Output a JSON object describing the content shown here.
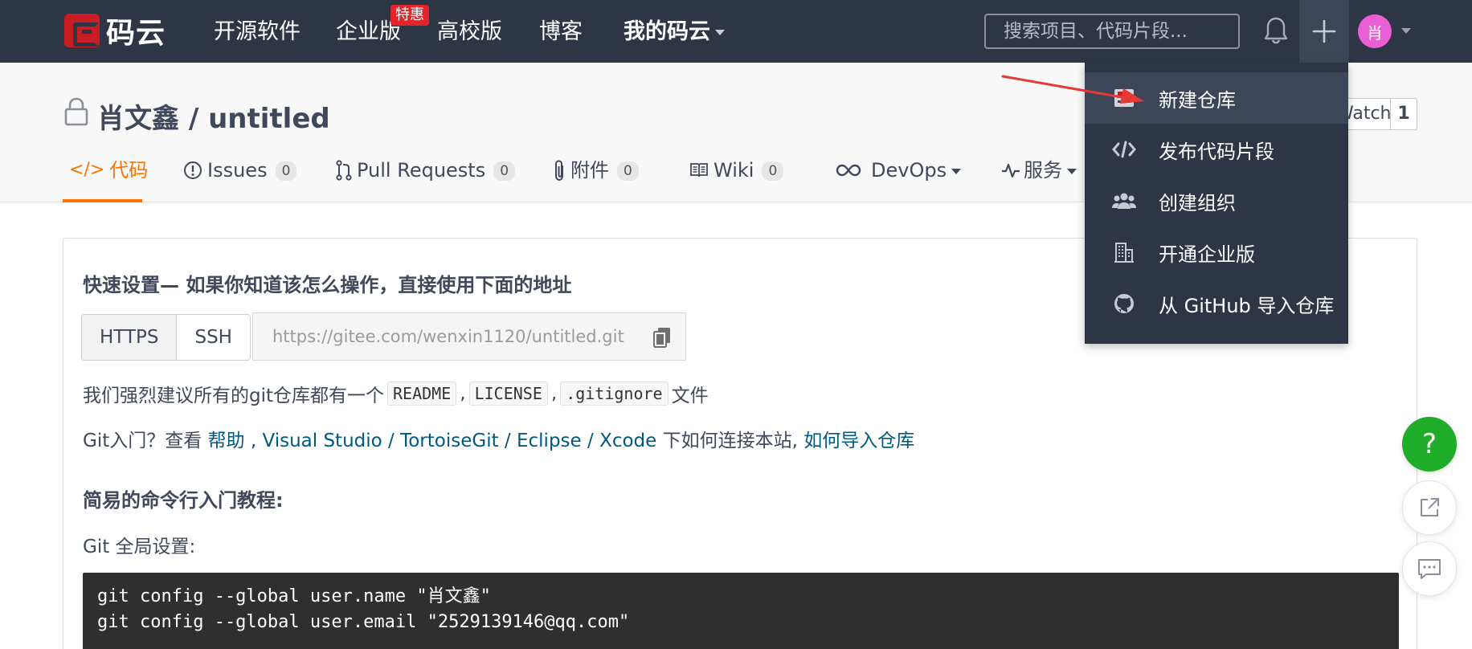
{
  "navbar": {
    "brand": "码云",
    "links": [
      {
        "label": "开源软件"
      },
      {
        "label": "企业版",
        "badge": "特惠"
      },
      {
        "label": "高校版"
      },
      {
        "label": "博客"
      },
      {
        "label": "我的码云"
      }
    ],
    "search_placeholder": "搜索项目、代码片段...",
    "avatar_text": "肖"
  },
  "repo": {
    "title": "肖文鑫 / untitled",
    "watch_label": "Watch",
    "watch_count": "1"
  },
  "tabs": [
    {
      "icon": "code-icon",
      "label": "代码"
    },
    {
      "icon": "issue-icon",
      "label": "Issues",
      "count": "0"
    },
    {
      "icon": "pull-request-icon",
      "label": "Pull Requests",
      "count": "0"
    },
    {
      "icon": "paperclip-icon",
      "label": "附件",
      "count": "0"
    },
    {
      "icon": "book-icon",
      "label": "Wiki",
      "count": "0"
    },
    {
      "icon": "infinity-icon",
      "label": "DevOps"
    },
    {
      "icon": "pulse-icon",
      "label": "服务"
    }
  ],
  "quick_setup": {
    "title": "快速设置— 如果你知道该怎么操作，直接使用下面的地址",
    "protocols": [
      "HTTPS",
      "SSH"
    ],
    "url": "https://gitee.com/wenxin1120/untitled.git",
    "advice_prefix": "我们强烈建议所有的git仓库都有一个",
    "advice_files": [
      "README",
      "LICENSE",
      ".gitignore"
    ],
    "advice_sep": ",",
    "advice_suffix": "文件",
    "help_prefix": "Git入门？查看",
    "help_link": "帮助",
    "ide_links": [
      "Visual Studio",
      "TortoiseGit",
      "Eclipse",
      "Xcode"
    ],
    "slash": "/",
    "help_middle": "下如何连接本站,",
    "import_link": "如何导入仓库"
  },
  "tutorial": {
    "title": "简易的命令行入门教程:",
    "global_label": "Git 全局设置:",
    "code_lines": [
      "git config --global user.name \"肖文鑫\"",
      "git config --global user.email \"2529139146@qq.com\""
    ]
  },
  "dropdown": {
    "items": [
      {
        "icon": "new-repo-icon",
        "label": "新建仓库"
      },
      {
        "icon": "code-snippet-icon",
        "label": "发布代码片段"
      },
      {
        "icon": "team-icon",
        "label": "创建组织"
      },
      {
        "icon": "building-icon",
        "label": "开通企业版"
      },
      {
        "icon": "github-icon",
        "label": "从 GitHub 导入仓库"
      }
    ]
  },
  "floating": {
    "help_label": "?"
  },
  "colors": {
    "navbar_bg": "#2e3646",
    "accent_orange": "#fe7300",
    "brand_red": "#c71d23",
    "link_blue": "#005980",
    "help_green": "#1fac29",
    "annotation_arrow": "#e53935"
  }
}
